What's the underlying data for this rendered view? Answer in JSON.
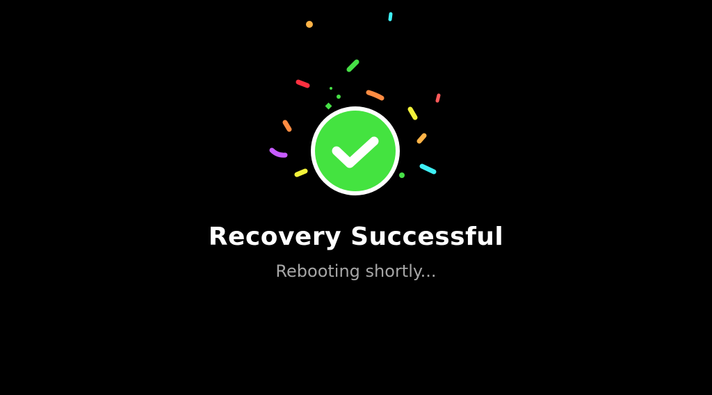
{
  "screen": {
    "title": "Recovery Successful",
    "subtitle": "Rebooting shortly...",
    "status_icon": "checkmark-circle-icon"
  },
  "colors": {
    "background": "#000000",
    "success_green": "#44e340",
    "badge_ring": "#ffffff",
    "title_text": "#ffffff",
    "subtitle_text": "#a6a6a6",
    "confetti": [
      "#ffb347",
      "#3ff0f5",
      "#47e047",
      "#ff3040",
      "#ff8c42",
      "#ff5a5a",
      "#f2f23a",
      "#c75bff"
    ]
  },
  "decoration": {
    "confetti_icon": "confetti-burst"
  }
}
